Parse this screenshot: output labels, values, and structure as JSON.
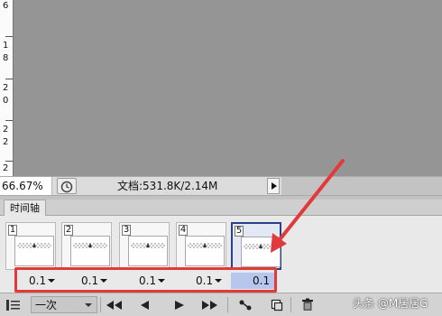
{
  "ruler": {
    "labels": [
      "6",
      "1",
      "8",
      "2",
      "0",
      "2",
      "2",
      "2"
    ]
  },
  "status": {
    "zoom": "66.67%",
    "doc_info": "文档:531.8K/2.14M"
  },
  "timeline": {
    "tab_label": "时间轴",
    "frames": [
      {
        "number": "1",
        "delay": "0.1"
      },
      {
        "number": "2",
        "delay": "0.1"
      },
      {
        "number": "3",
        "delay": "0.1"
      },
      {
        "number": "4",
        "delay": "0.1"
      },
      {
        "number": "5",
        "delay": "0.1"
      }
    ],
    "selected_frame": "5",
    "loop_option": "一次"
  },
  "annotation": {
    "color": "#e23a3a"
  },
  "watermark": "头条 @M居居G",
  "icons": [
    "ruler",
    "timer-icon",
    "panel-menu-icon",
    "first-frame-icon",
    "previous-frame-icon",
    "play-icon",
    "next-frame-icon",
    "tween-icon",
    "duplicate-frame-icon",
    "delete-frame-icon"
  ]
}
